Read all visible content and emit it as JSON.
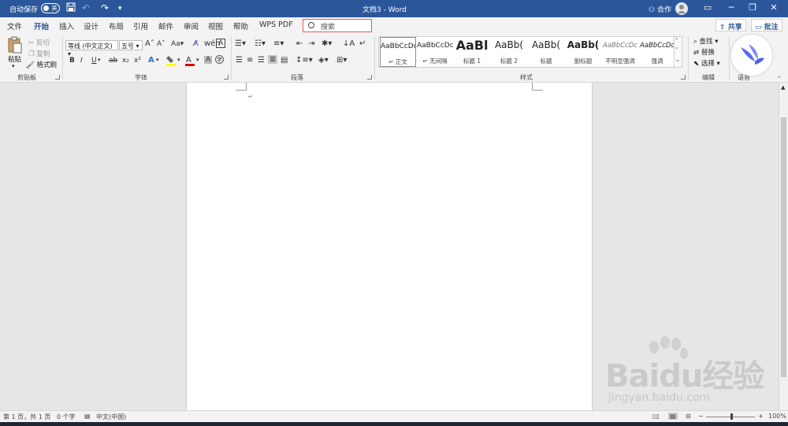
{
  "titlebar": {
    "autosave_label": "自动保存",
    "autosave_state": "关",
    "document_title": "文档3 - Word",
    "coauthor_label": "合作",
    "window_buttons": [
      "─",
      "❐",
      "✕"
    ]
  },
  "tabs": [
    "文件",
    "开始",
    "插入",
    "设计",
    "布局",
    "引用",
    "邮件",
    "审阅",
    "视图",
    "帮助",
    "WPS PDF"
  ],
  "active_tab": "开始",
  "search": {
    "placeholder": "搜索"
  },
  "share_button": "共享",
  "comment_button": "批注",
  "ribbon": {
    "clipboard": {
      "label": "剪贴板",
      "paste": "粘贴",
      "cut": "剪切",
      "copy": "复制",
      "format_painter": "格式刷"
    },
    "font": {
      "label": "字体",
      "font_name": "等线 (中文正文)",
      "font_size": "五号",
      "grow": "A",
      "shrink": "A",
      "case": "Aa",
      "bold": "B",
      "italic": "I",
      "underline": "U",
      "strike": "ab",
      "subscript": "x₂",
      "superscript": "x²"
    },
    "paragraph": {
      "label": "段落"
    },
    "styles": {
      "label": "样式",
      "items": [
        {
          "sample": "AaBbCcDc",
          "name": "↵ 正文",
          "selected": true
        },
        {
          "sample": "AaBbCcDc",
          "name": "↵ 无间隔",
          "selected": false
        },
        {
          "sample": "AaBl",
          "name": "标题 1",
          "selected": false
        },
        {
          "sample": "AaBb(",
          "name": "标题 2",
          "selected": false
        },
        {
          "sample": "AaBb(",
          "name": "标题",
          "selected": false
        },
        {
          "sample": "AaBb(",
          "name": "副标题",
          "selected": false
        },
        {
          "sample": "AaBbCcDc",
          "name": "不明显强调",
          "selected": false
        },
        {
          "sample": "AaBbCcDc",
          "name": "强调",
          "selected": false
        }
      ]
    },
    "editing": {
      "label": "编辑",
      "find": "查找",
      "replace": "替换",
      "select": "选择"
    },
    "voice": {
      "label": "语音"
    }
  },
  "statusbar": {
    "page": "第 1 页，共 1 页",
    "words": "0 个字",
    "language": "中文(中国)",
    "zoom": "100%"
  },
  "watermark": {
    "brand": "Baidu经验",
    "url": "jingyan.baidu.com"
  },
  "colors": {
    "accent": "#2b579a",
    "highlight": "#ffff00",
    "font_color": "#e00000"
  }
}
